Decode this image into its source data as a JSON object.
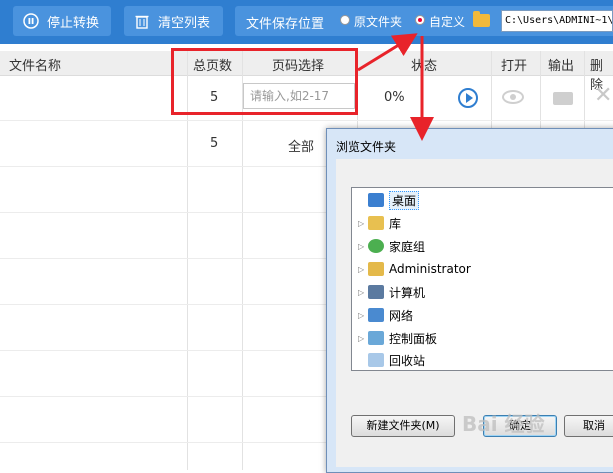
{
  "toolbar": {
    "stop_label": "停止转换",
    "clear_label": "清空列表",
    "save_location_label": "文件保存位置",
    "option_original": "原文件夹",
    "option_custom": "自定义",
    "path_value": "C:\\Users\\ADMINI~1\\"
  },
  "table": {
    "headers": {
      "name": "文件名称",
      "pages": "总页数",
      "page_select": "页码选择",
      "status": "状态",
      "open": "打开",
      "output": "输出",
      "delete": "删除"
    },
    "rows": [
      {
        "pages": "5",
        "page_select_placeholder": "请输入,如2-17",
        "status": "0%"
      },
      {
        "pages": "5",
        "page_select": "全部"
      }
    ]
  },
  "dialog": {
    "title": "浏览文件夹",
    "tree": [
      {
        "label": "桌面",
        "icon": "desktop-icon"
      },
      {
        "label": "库",
        "icon": "library-icon"
      },
      {
        "label": "家庭组",
        "icon": "homegroup-icon"
      },
      {
        "label": "Administrator",
        "icon": "user-folder-icon"
      },
      {
        "label": "计算机",
        "icon": "computer-icon"
      },
      {
        "label": "网络",
        "icon": "network-icon"
      },
      {
        "label": "控制面板",
        "icon": "control-panel-icon"
      },
      {
        "label": "回收站",
        "icon": "recycle-bin-icon"
      }
    ],
    "new_folder_label": "新建文件夹(M)",
    "ok_label": "确定",
    "cancel_label": "取消"
  },
  "watermark": "Bai 经验",
  "colors": {
    "toolbar_bg": "#2f7ed0",
    "highlight": "#e8232a",
    "accent": "#2f7ed0"
  }
}
